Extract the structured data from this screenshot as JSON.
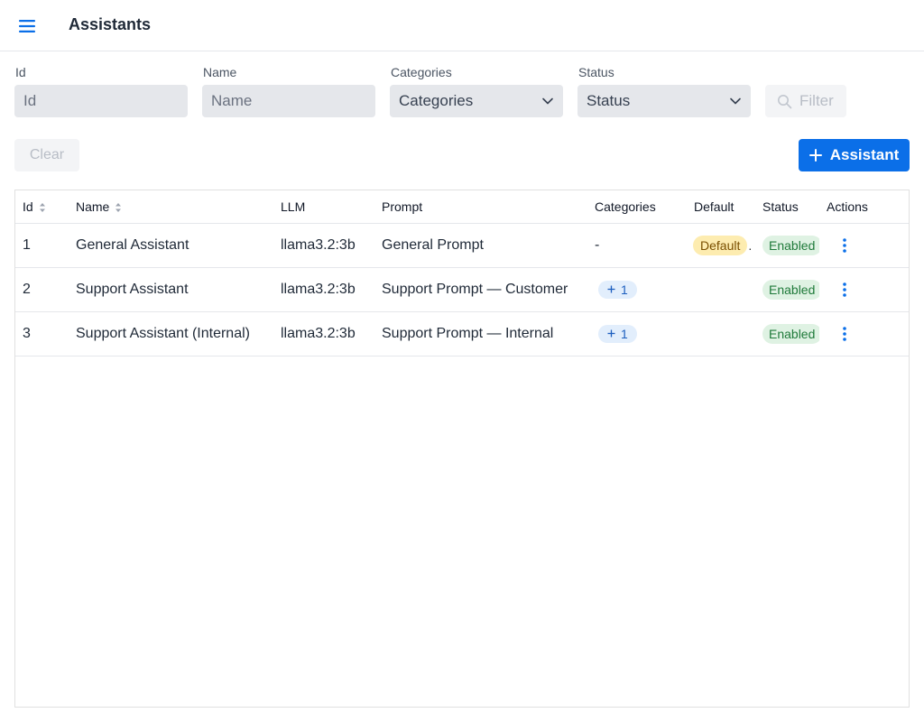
{
  "header": {
    "title": "Assistants"
  },
  "filters": {
    "id": {
      "label": "Id",
      "placeholder": "Id"
    },
    "name": {
      "label": "Name",
      "placeholder": "Name"
    },
    "categories": {
      "label": "Categories",
      "value": "Categories"
    },
    "status": {
      "label": "Status",
      "value": "Status"
    },
    "filter_button": "Filter"
  },
  "actions": {
    "clear_label": "Clear",
    "add_label": "Assistant"
  },
  "table": {
    "columns": [
      "Id",
      "Name",
      "LLM",
      "Prompt",
      "Categories",
      "Default",
      "Status",
      "Actions"
    ],
    "rows": [
      {
        "id": "1",
        "name": "General Assistant",
        "llm": "llama3.2:3b",
        "prompt": "General Prompt",
        "categories": "-",
        "default": "Default",
        "status": "Enabled"
      },
      {
        "id": "2",
        "name": "Support Assistant",
        "llm": "llama3.2:3b",
        "prompt": "Support Prompt — Customer",
        "categories": "1",
        "default": "",
        "status": "Enabled"
      },
      {
        "id": "3",
        "name": "Support Assistant (Internal)",
        "llm": "llama3.2:3b",
        "prompt": "Support Prompt — Internal",
        "categories": "1",
        "default": "",
        "status": "Enabled"
      }
    ]
  },
  "icons": {
    "menu": "hamburger-icon",
    "search": "search-icon",
    "add": "plus-icon",
    "sort": "sort-icon",
    "actions": "kebab-icon",
    "dropdown": "chevron-down-icon"
  },
  "colors": {
    "primary": "#0b6fe8",
    "enabled_bg": "#dff2e3",
    "enabled_text": "#1f7a3a",
    "default_bg": "#fdecb0",
    "count_bg": "#e2eefc"
  }
}
